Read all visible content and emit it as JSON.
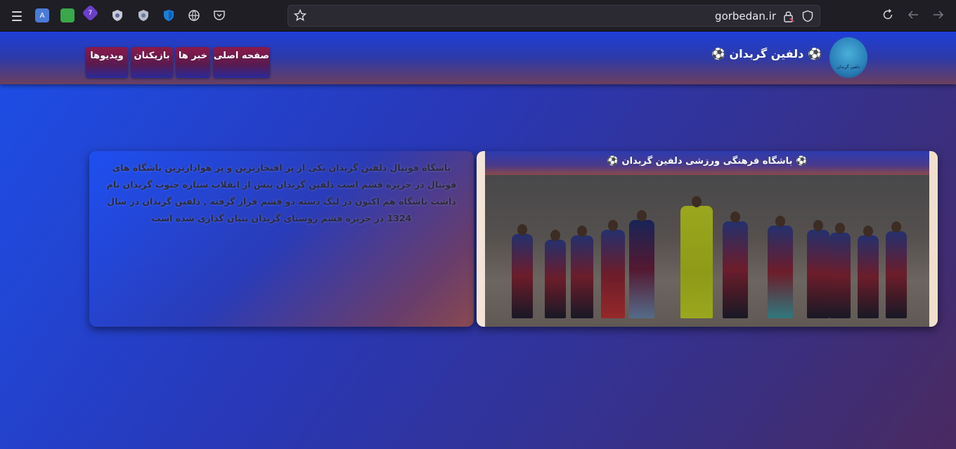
{
  "browser": {
    "url": "gorbedan.ir",
    "extension_badge": "7",
    "translate_label": "A"
  },
  "site": {
    "title": "⚽ دلفین گربدان ⚽",
    "logo_text": "دلفین گربدان"
  },
  "nav": {
    "home": "صفحه اصلی",
    "news": "خبر ها",
    "players": "بازیکنان",
    "videos": "ویدیوها"
  },
  "intro": {
    "text": "باشگاه فوتبال دلفین گربدان یکی از پر افتخارترین و پر هوادارترین باشگاه های فوتبال در جزیره قشم است دلفین گربدان پیش از انقلاب ستاره جنوب گربدان نام داشت باشگاه هم اکنون در لیگ دسته دو قشم قرار گرفته , دلفین گربدان در سال 1324 در جزیره قشم روستای گربدان بنیان گذاری شده است"
  },
  "photo_card": {
    "title": "⚽ باشگاه فرهنگی ورزشی دلفین گربدان ⚽"
  },
  "colors": {
    "page_start": "#1d4fe8",
    "page_end": "#4a2a60",
    "nav_top": "#8a1a4a",
    "nav_bottom": "#2a2a9a"
  }
}
